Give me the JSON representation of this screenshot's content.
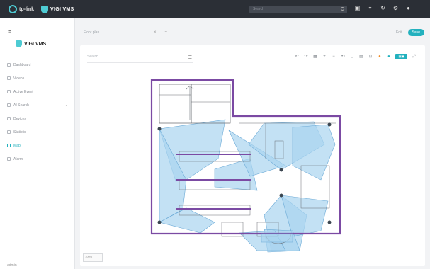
{
  "top": {
    "brand1": "tp-link",
    "brand2": "VIGI VMS",
    "search_placeholder": "Search"
  },
  "side": {
    "logo": "VIGI VMS",
    "items": [
      {
        "label": "Dashboard",
        "active": false
      },
      {
        "label": "Videos",
        "active": false
      },
      {
        "label": "Active Event",
        "active": false
      },
      {
        "label": "AI Search",
        "active": false,
        "expand": true
      },
      {
        "label": "Devices",
        "active": false
      },
      {
        "label": "Statistic",
        "active": false
      },
      {
        "label": "Map",
        "active": true
      },
      {
        "label": "Alarm",
        "active": false
      }
    ],
    "footer": "admin"
  },
  "tabs": {
    "current": "Floor plan",
    "plus": "+",
    "close": "×",
    "edit": "Edit",
    "save": "Save"
  },
  "map": {
    "select_placeholder": "Search",
    "zoom_label": "100%"
  },
  "colors": {
    "accent": "#23b1be",
    "wall": "#7b4aa3",
    "fov": "#a9d4ef"
  }
}
